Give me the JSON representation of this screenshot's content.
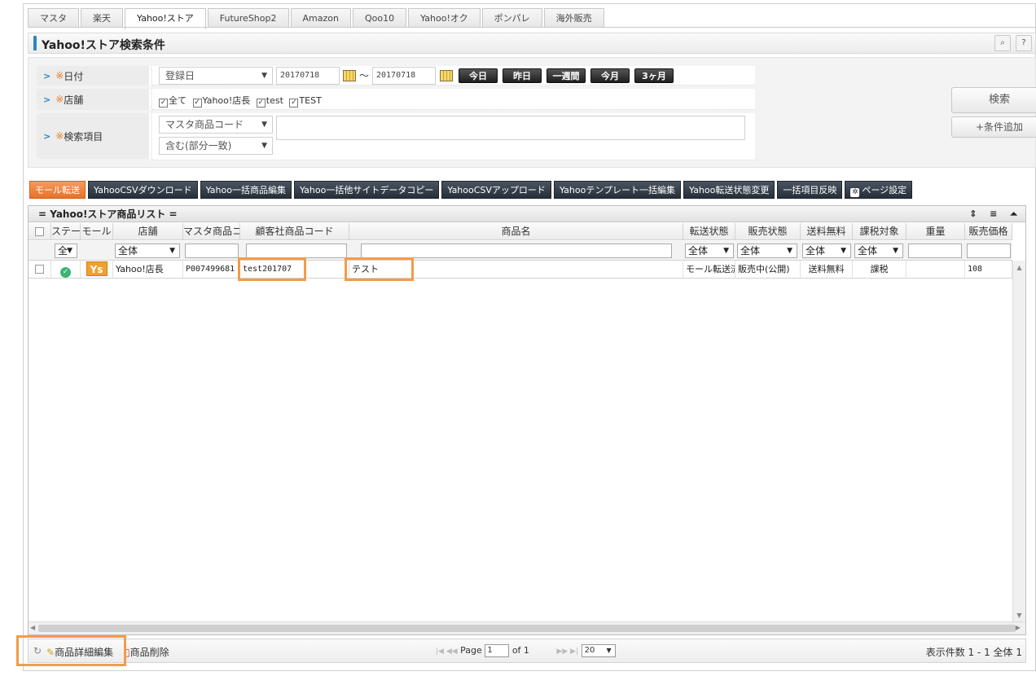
{
  "tabs": [
    "マスタ",
    "楽天",
    "Yahoo!ストア",
    "FutureShop2",
    "Amazon",
    "Qoo10",
    "Yahoo!オク",
    "ポンパレ",
    "海外販売"
  ],
  "section": {
    "title": "Yahoo!ストア検索条件",
    "zoom_icon": "⌕",
    "help_icon": "?"
  },
  "search": {
    "date_label": "日付",
    "req_mark": "※",
    "date_type": "登録日",
    "date_from": "20170718",
    "tilde": "～",
    "date_to": "20170718",
    "quick": [
      "今日",
      "昨日",
      "一週間",
      "今月",
      "3ヶ月"
    ],
    "store_label": "店舗",
    "stores": [
      "全て",
      "Yahoo!店長",
      "test",
      "TEST"
    ],
    "item_label": "検索項目",
    "item_field": "マスタ商品コード",
    "match_type": "含む(部分一致)",
    "keyword": "",
    "search_button": "検索",
    "add_condition_button": "+条件追加"
  },
  "actions": [
    "モール転送",
    "YahooCSVダウンロード",
    "Yahoo一括商品編集",
    "Yahoo一括他サイトデータコピー",
    "YahooCSVアップロード",
    "Yahooテンプレート一括編集",
    "Yahoo転送状態変更",
    "一括項目反映",
    "ページ設定"
  ],
  "grid": {
    "title": "Yahoo!ストア商品リスト",
    "title_marks": "= ",
    "controls": "⇕ ≡ ⏶",
    "columns": [
      "ステー",
      "モール",
      "店舗",
      "マスタ商品コ",
      "顧客社商品コード",
      "商品名",
      "転送状態",
      "販売状態",
      "送料無料",
      "課税対象",
      "重量",
      "販売価格"
    ],
    "filters": {
      "status": "全",
      "store": "全体",
      "transfer": "全体",
      "sale": "全体",
      "shipping": "全体",
      "tax": "全体"
    },
    "row": {
      "status_icon": "✓",
      "mall": "Ys",
      "store": "Yahoo!店長",
      "master_code": "P007499681",
      "customer_code": "test201707",
      "name": "テスト",
      "transfer": "モール転送済",
      "sale": "販売中(公開)",
      "shipping": "送料無料",
      "tax": "課税",
      "weight": "",
      "price": "108"
    }
  },
  "footer": {
    "refresh_icon": "↻",
    "edit_label": "商品詳細編集",
    "delete_label": "商品削除",
    "page_label": "Page",
    "page_value": "1",
    "of_label": "of 1",
    "per_page": "20",
    "count_text": "表示件数 1 - 1 全体 1"
  },
  "colors": {
    "accent": "#f39c4a",
    "title_bar": "#2e86c1",
    "ok": "#3cb371"
  }
}
